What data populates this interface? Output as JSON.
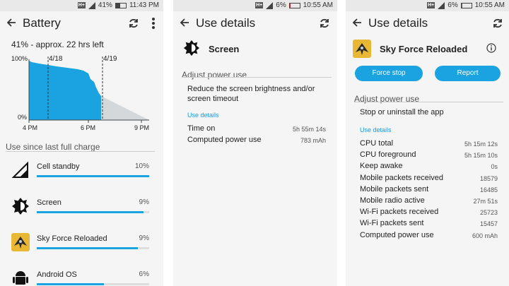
{
  "panel1": {
    "status": {
      "signal": "H+",
      "battery_pct": "41%",
      "time": "11:43 PM"
    },
    "title": "Battery",
    "summary": "41% - approx. 22 hrs left",
    "chart_labels": {
      "y_top": "100%",
      "y_bottom": "0%",
      "marker1": "4/18",
      "marker2": "4/19"
    },
    "chart_x_ticks": [
      "4 PM",
      "6 PM",
      "9 PM"
    ],
    "section": "Use since last full charge",
    "items": [
      {
        "label": "Cell standby",
        "pct": "10%",
        "fill": 1.0,
        "icon": "signal-icon"
      },
      {
        "label": "Screen",
        "pct": "9%",
        "fill": 0.95,
        "icon": "brightness-icon"
      },
      {
        "label": "Sky Force Reloaded",
        "pct": "9%",
        "fill": 0.9,
        "icon": "game-icon"
      },
      {
        "label": "Android OS",
        "pct": "6%",
        "fill": 0.6,
        "icon": "android-icon"
      }
    ]
  },
  "panel2": {
    "status": {
      "signal": "H+",
      "battery_pct": "6%",
      "time": "10:55 AM"
    },
    "title": "Use details",
    "app_name": "Screen",
    "adjust_header": "Adjust power use",
    "adjust_text": "Reduce the screen brightness and/or screen timeout",
    "use_details_label": "Use details",
    "details": [
      {
        "key": "Time on",
        "value": "5h 55m 14s"
      },
      {
        "key": "Computed power use",
        "value": "783 mAh"
      }
    ]
  },
  "panel3": {
    "status": {
      "signal": "H+",
      "battery_pct": "6%",
      "time": "10:55 AM"
    },
    "title": "Use details",
    "app_name": "Sky Force Reloaded",
    "force_stop": "Force stop",
    "report": "Report",
    "adjust_header": "Adjust power use",
    "adjust_text": "Stop or uninstall the app",
    "use_details_label": "Use details",
    "details": [
      {
        "key": "CPU total",
        "value": "5h 15m 12s"
      },
      {
        "key": "CPU foreground",
        "value": "5h 15m 10s"
      },
      {
        "key": "Keep awake",
        "value": "0s"
      },
      {
        "key": "Mobile packets received",
        "value": "18579"
      },
      {
        "key": "Mobile packets sent",
        "value": "16485"
      },
      {
        "key": "Mobile radio active",
        "value": "27m 51s"
      },
      {
        "key": "Wi-Fi packets received",
        "value": "25723"
      },
      {
        "key": "Wi-Fi packets sent",
        "value": "15457"
      },
      {
        "key": "Computed power use",
        "value": "600 mAh"
      }
    ]
  },
  "colors": {
    "accent": "#1aa3e0",
    "projection": "#d5d8db"
  }
}
